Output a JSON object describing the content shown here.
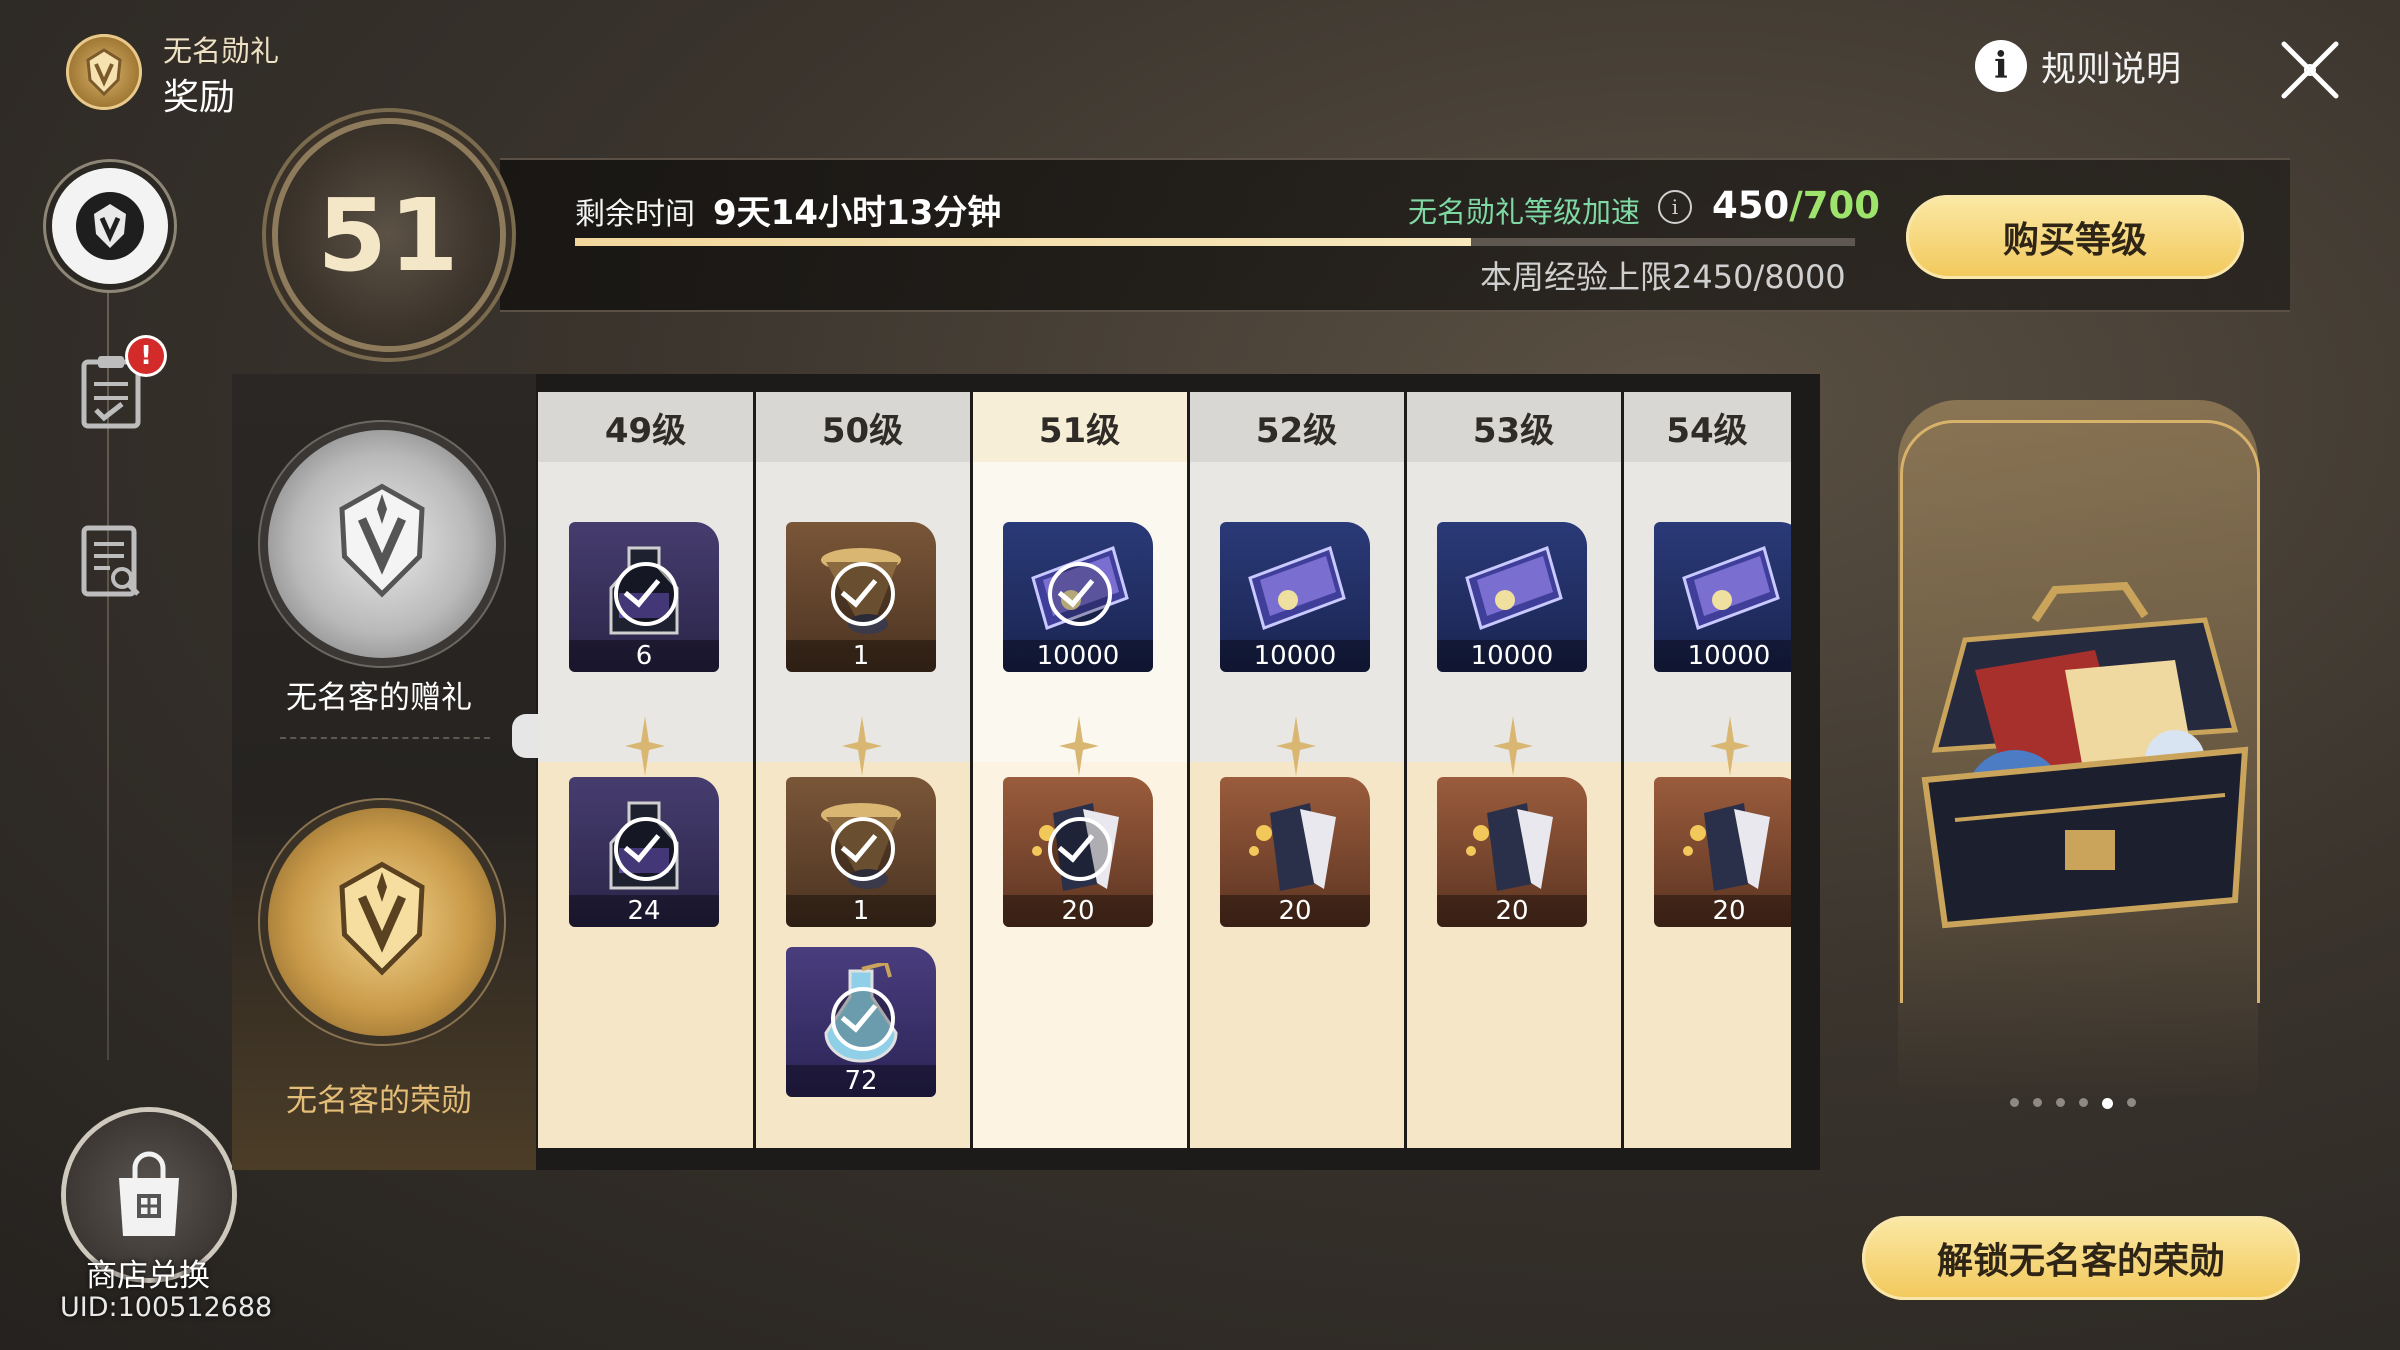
{
  "header": {
    "subtitle": "无名勋礼",
    "title": "奖励",
    "rules_label": "规则说明",
    "info_icon": "i"
  },
  "nav": {
    "items": [
      "badge-icon",
      "task-list-icon",
      "log-icon"
    ],
    "task_badge": "!",
    "shop_label": "商店兑换",
    "uid": "UID:100512688"
  },
  "level": {
    "current": "51",
    "time_label": "剩余时间",
    "time_value": "9天14小时13分钟",
    "time_progress": 0.7,
    "boost_label": "无名勋礼等级加速",
    "exp_current": "450",
    "exp_max": "/700",
    "weekly_cap": "本周经验上限2450/8000",
    "buy_button": "购买等级"
  },
  "tiers": {
    "free_name": "无名客的赠礼",
    "paid_name": "无名客的荣勋"
  },
  "rewards": [
    {
      "level": "49级",
      "current": false,
      "free": [
        {
          "count": "6",
          "claimed": true,
          "bg": "bg-purple",
          "art": "bottle"
        }
      ],
      "paid": [
        {
          "count": "24",
          "claimed": true,
          "bg": "bg-purple",
          "art": "bottle"
        }
      ]
    },
    {
      "level": "50级",
      "current": false,
      "free": [
        {
          "count": "1",
          "claimed": true,
          "bg": "bg-brown",
          "art": "horn"
        }
      ],
      "paid": [
        {
          "count": "1",
          "claimed": true,
          "bg": "bg-brown",
          "art": "horn"
        },
        {
          "count": "72",
          "claimed": true,
          "bg": "bg-violet",
          "art": "flask"
        }
      ]
    },
    {
      "level": "51级",
      "current": true,
      "free": [
        {
          "count": "10000",
          "claimed": true,
          "bg": "bg-navy",
          "art": "card"
        }
      ],
      "paid": [
        {
          "count": "20",
          "claimed": true,
          "bg": "bg-rust",
          "art": "book"
        }
      ]
    },
    {
      "level": "52级",
      "current": false,
      "free": [
        {
          "count": "10000",
          "claimed": false,
          "bg": "bg-navy",
          "art": "card"
        }
      ],
      "paid": [
        {
          "count": "20",
          "claimed": false,
          "bg": "bg-rust",
          "art": "book"
        }
      ]
    },
    {
      "level": "53级",
      "current": false,
      "free": [
        {
          "count": "10000",
          "claimed": false,
          "bg": "bg-navy",
          "art": "card"
        }
      ],
      "paid": [
        {
          "count": "20",
          "claimed": false,
          "bg": "bg-rust",
          "art": "book"
        }
      ]
    },
    {
      "level": "54级",
      "current": false,
      "free": [
        {
          "count": "10000",
          "claimed": false,
          "bg": "bg-navy",
          "art": "card"
        }
      ],
      "paid": [
        {
          "count": "20",
          "claimed": false,
          "bg": "bg-rust",
          "art": "book"
        }
      ]
    }
  ],
  "preview": {
    "carousel_count": 6,
    "carousel_active": 4,
    "unlock_button": "解锁无名客的荣勋"
  },
  "colors": {
    "accent_gold": "#f2c85a",
    "boost_green": "#7fd9a5",
    "exp_max_green": "#9de36c",
    "badge_red": "#d32a2a"
  }
}
